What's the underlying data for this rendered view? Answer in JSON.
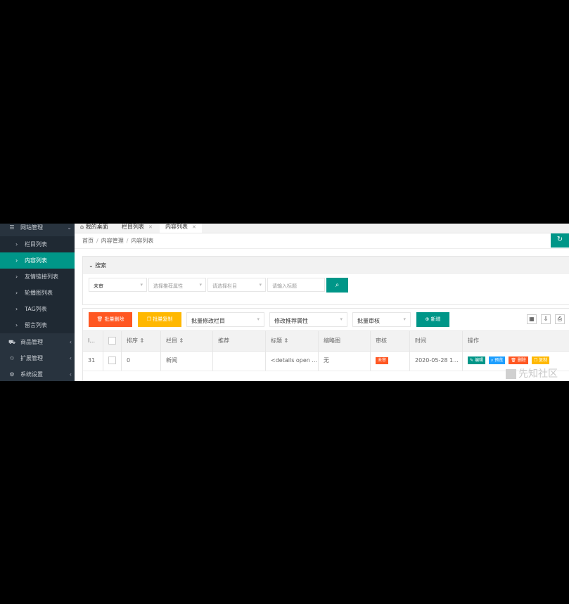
{
  "sidebar": {
    "groups": [
      {
        "label": "网站管理",
        "icon": "list-icon"
      },
      {
        "label": "商品管理",
        "icon": "cart-icon"
      },
      {
        "label": "扩展管理",
        "icon": "extension-icon"
      },
      {
        "label": "系统设置",
        "icon": "settings-icon"
      }
    ],
    "items": [
      {
        "label": "栏目列表"
      },
      {
        "label": "内容列表",
        "active": true
      },
      {
        "label": "友情链接列表"
      },
      {
        "label": "轮播图列表"
      },
      {
        "label": "TAG列表"
      },
      {
        "label": "留言列表"
      }
    ]
  },
  "tabs": [
    {
      "label": "我的桌面"
    },
    {
      "label": "栏目列表"
    },
    {
      "label": "内容列表",
      "active": true
    }
  ],
  "breadcrumb": [
    "首页",
    "内容管理",
    "内容列表"
  ],
  "search": {
    "title": "搜索",
    "status_value": "未审",
    "recommend_placeholder": "选择推荐属性",
    "column_placeholder": "请选择栏目",
    "title_placeholder": "请输入标题"
  },
  "toolbar": {
    "batch_delete": "批量删除",
    "batch_copy": "批量复制",
    "batch_column": "批量修改栏目",
    "modify_recommend": "修改推荐属性",
    "batch_review": "批量审核",
    "add": "新增"
  },
  "table": {
    "headers": [
      "I...",
      "",
      "排序",
      "栏目",
      "推荐",
      "标题",
      "缩略图",
      "审核",
      "时间",
      "操作"
    ],
    "rows": [
      {
        "id": "31",
        "sort": "0",
        "column": "新闻",
        "recommend": "",
        "title": "<details open ...",
        "thumb": "无",
        "review": "未审",
        "time": "2020-05-28 1...",
        "actions": [
          "编辑",
          "预览",
          "删除",
          "复制"
        ]
      }
    ]
  },
  "watermark": "先知社区",
  "colors": {
    "primary": "#009688",
    "danger": "#ff5722",
    "warn": "#ffb800",
    "info": "#1e9fff",
    "sidebar": "#28333e"
  }
}
